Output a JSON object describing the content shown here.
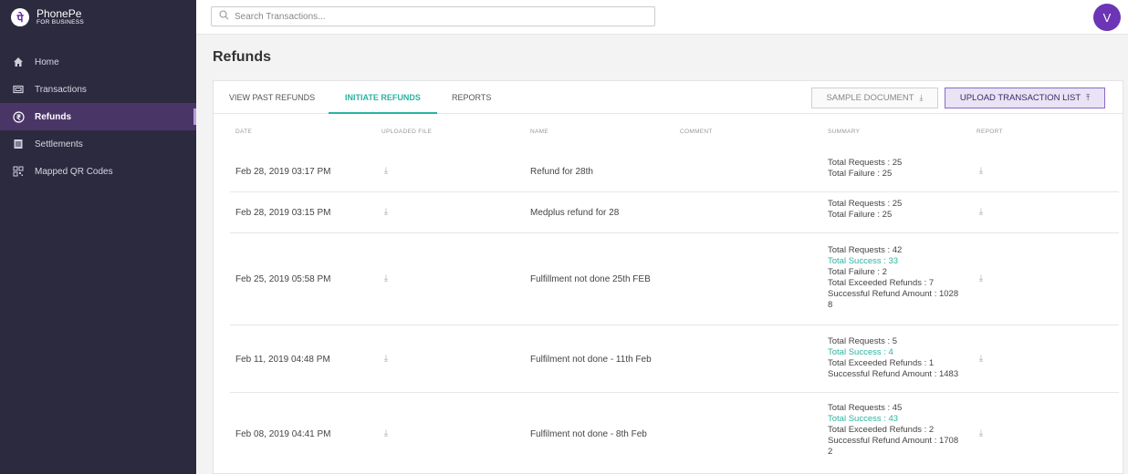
{
  "brand": {
    "name": "PhonePe",
    "sub": "FOR BUSINESS",
    "logo_glyph": "पे"
  },
  "search": {
    "placeholder": "Search Transactions..."
  },
  "user": {
    "avatar_letter": "V"
  },
  "sidebar": {
    "items": [
      {
        "label": "Home",
        "icon": "home-icon"
      },
      {
        "label": "Transactions",
        "icon": "transactions-icon"
      },
      {
        "label": "Refunds",
        "icon": "rupee-icon",
        "active": true
      },
      {
        "label": "Settlements",
        "icon": "settlements-icon"
      },
      {
        "label": "Mapped QR Codes",
        "icon": "qr-icon"
      }
    ]
  },
  "page": {
    "title": "Refunds"
  },
  "tabs": [
    {
      "label": "VIEW PAST REFUNDS"
    },
    {
      "label": "INITIATE REFUNDS",
      "active": true
    },
    {
      "label": "REPORTS"
    }
  ],
  "buttons": {
    "sample": "SAMPLE DOCUMENT",
    "upload": "UPLOAD TRANSACTION LIST"
  },
  "table": {
    "headers": {
      "date": "DATE",
      "file": "UPLOADED FILE",
      "name": "NAME",
      "comment": "COMMENT",
      "summary": "SUMMARY",
      "report": "REPORT"
    },
    "rows": [
      {
        "date": "Feb 28, 2019 03:17 PM",
        "name": "Refund for 28th",
        "summary": [
          "Total Requests : 25",
          "Total Failure : 25"
        ]
      },
      {
        "date": "Feb 28, 2019 03:15 PM",
        "name": "Medplus refund for 28",
        "summary": [
          "Total Requests : 25",
          "Total Failure : 25"
        ]
      },
      {
        "date": "Feb 25, 2019 05:58 PM",
        "name": "Fulfillment not done 25th FEB",
        "summary": [
          "Total Requests : 42",
          "Total Success : 33",
          "Total Failure : 2",
          "Total Exceeded Refunds : 7",
          "Successful Refund Amount : 1028",
          "8"
        ]
      },
      {
        "date": "Feb 11, 2019 04:48 PM",
        "name": "Fulfilment not done - 11th Feb",
        "summary": [
          "Total Requests : 5",
          "Total Success : 4",
          "Total Exceeded Refunds : 1",
          "Successful Refund Amount : 1483"
        ]
      },
      {
        "date": "Feb 08, 2019 04:41 PM",
        "name": "Fulfilment not done - 8th Feb",
        "summary": [
          "Total Requests : 45",
          "Total Success : 43",
          "Total Exceeded Refunds : 2",
          "Successful Refund Amount : 1708",
          "2"
        ]
      }
    ]
  },
  "colors": {
    "sidebar": "#2c2a3f",
    "accent": "#2bb3a0",
    "brand": "#6b35b5"
  }
}
